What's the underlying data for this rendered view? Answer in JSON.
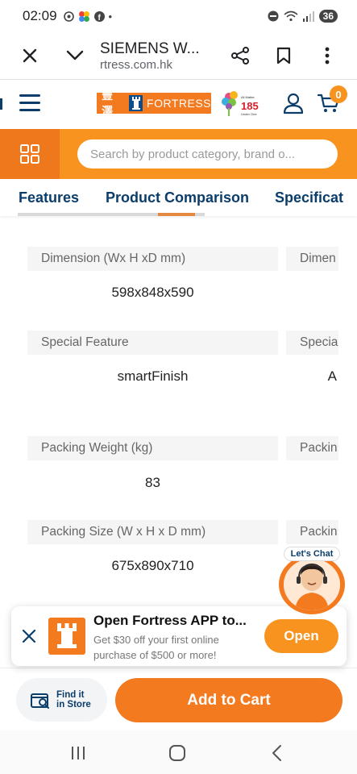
{
  "status_bar": {
    "time": "02:09",
    "notification_icons": [
      "camera-icon",
      "pinwheel-icon",
      "facebook-icon"
    ],
    "dot": "•",
    "battery": "36"
  },
  "browser": {
    "title": "SIEMENS W...",
    "url": "rtress.com.hk"
  },
  "header": {
    "logo_cn": "豐澤",
    "logo_en": "FORTRESS",
    "anniversary_logo": "All Matter 185 Under One",
    "cart_count": "0"
  },
  "search": {
    "placeholder": "Search by product category, brand o..."
  },
  "tabs": [
    {
      "label": "Features"
    },
    {
      "label": "Product Comparison"
    },
    {
      "label": "Specificat"
    }
  ],
  "specs": [
    {
      "label": "Dimension (Wx H xD mm)",
      "value": "598x848x590",
      "label2": "Dimen",
      "value2": ""
    },
    {
      "label": "Special Feature",
      "value": "smartFinish",
      "label2": "Specia",
      "value2": "A"
    },
    {
      "label": "Packing Weight (kg)",
      "value": "83",
      "label2": "Packin",
      "value2": ""
    },
    {
      "label": "Packing Size (W x H x D mm)",
      "value": "675x890x710",
      "label2": "Packin",
      "value2": ""
    }
  ],
  "chat": {
    "label": "Let's Chat"
  },
  "app_banner": {
    "title": "Open Fortress APP to...",
    "subtitle": "Get $30 off your first online purchase of $500 or more!",
    "open_label": "Open"
  },
  "actions": {
    "find_line1": "Find it",
    "find_line2": "in Store",
    "add_to_cart": "Add to Cart"
  },
  "colors": {
    "brand_orange": "#f47a20",
    "accent_orange": "#f7931e",
    "navy": "#0b3d6b"
  }
}
